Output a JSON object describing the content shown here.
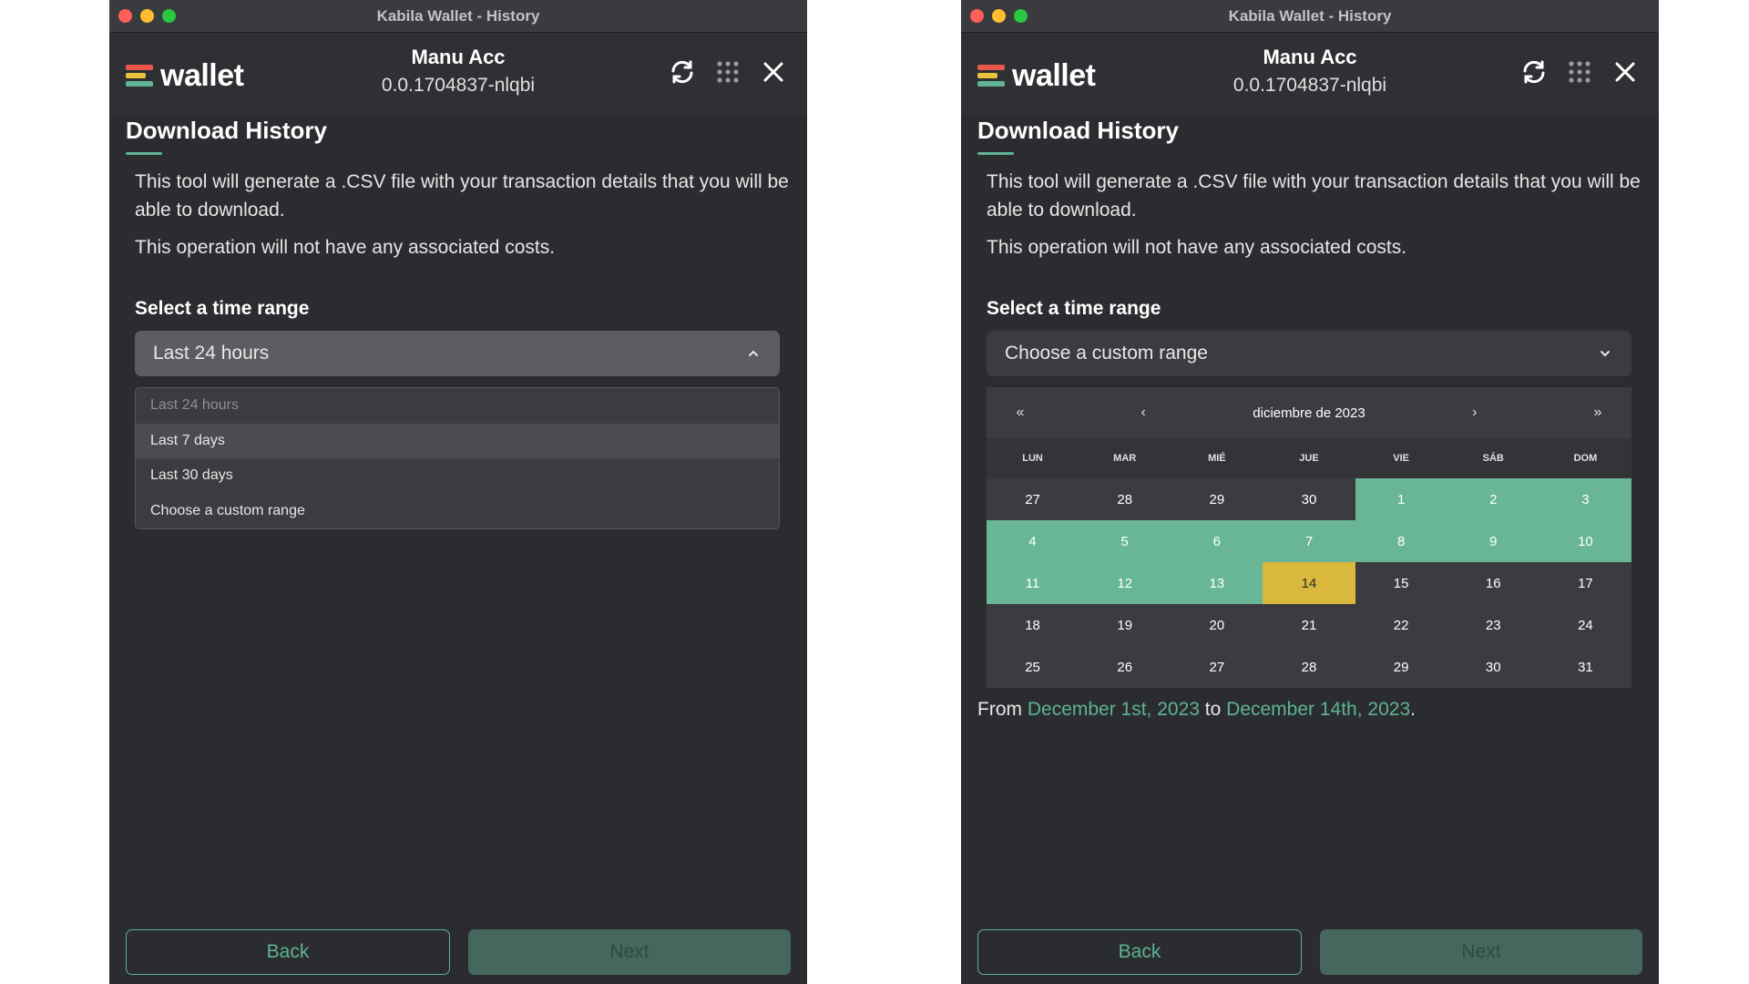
{
  "window_title": "Kabila Wallet - History",
  "brand": "wallet",
  "account": {
    "name": "Manu Acc",
    "id": "0.0.1704837-nlqbi"
  },
  "page_title": "Download History",
  "description": "This tool will generate a .CSV file with your transaction details that you will be able to download.",
  "cost_note": "This operation will not have any associated costs.",
  "range_label": "Select a time range",
  "left": {
    "selected": "Last 24 hours",
    "options": [
      "Last 24 hours",
      "Last 7 days",
      "Last 30 days",
      "Choose a custom range"
    ]
  },
  "right": {
    "selected": "Choose a custom range",
    "calendar": {
      "month_label": "diciembre de 2023",
      "nav": {
        "prev_year": "«",
        "prev_month": "‹",
        "next_month": "›",
        "next_year": "»"
      },
      "weekdays": [
        "LUN",
        "MAR",
        "MIÉ",
        "JUE",
        "VIE",
        "SÁB",
        "DOM"
      ],
      "days": [
        "27",
        "28",
        "29",
        "30",
        "1",
        "2",
        "3",
        "4",
        "5",
        "6",
        "7",
        "8",
        "9",
        "10",
        "11",
        "12",
        "13",
        "14",
        "15",
        "16",
        "17",
        "18",
        "19",
        "20",
        "21",
        "22",
        "23",
        "24",
        "25",
        "26",
        "27",
        "28",
        "29",
        "30",
        "31"
      ],
      "range_start_index": 4,
      "range_end_index": 17,
      "today_index": 17
    },
    "range_summary": {
      "from": "From",
      "start": "December 1st, 2023",
      "to": "to",
      "end": "December 14th, 2023",
      "suffix": "."
    }
  },
  "buttons": {
    "back": "Back",
    "next": "Next"
  },
  "colors": {
    "accent": "#5fb393",
    "range": "#68b696",
    "today": "#d9b83b",
    "background": "#2b2c30"
  }
}
